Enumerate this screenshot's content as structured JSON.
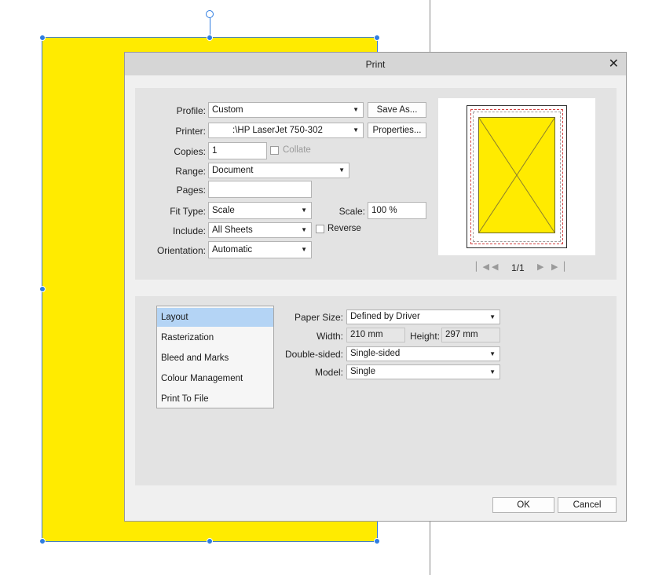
{
  "dialog": {
    "title": "Print",
    "close": "✕"
  },
  "general": {
    "profile": {
      "label": "Profile:",
      "value": "Custom"
    },
    "save_as": "Save As...",
    "printer": {
      "label": "Printer:",
      "value": ":\\HP LaserJet 750-302"
    },
    "properties": "Properties...",
    "copies": {
      "label": "Copies:",
      "value": "1"
    },
    "collate": "Collate",
    "range": {
      "label": "Range:",
      "value": "Document"
    },
    "pages": {
      "label": "Pages:",
      "value": ""
    },
    "fit_type": {
      "label": "Fit Type:",
      "value": "Scale"
    },
    "scale": {
      "label": "Scale:",
      "value": "100 %"
    },
    "include": {
      "label": "Include:",
      "value": "All Sheets"
    },
    "reverse": "Reverse",
    "orientation": {
      "label": "Orientation:",
      "value": "Automatic"
    }
  },
  "preview": {
    "page_counter": "1/1",
    "first_icon": "first-page-icon",
    "prev_icon": "prev-page-icon",
    "next_icon": "next-page-icon",
    "last_icon": "last-page-icon"
  },
  "sections": [
    {
      "label": "Layout",
      "selected": true
    },
    {
      "label": "Rasterization",
      "selected": false
    },
    {
      "label": "Bleed and Marks",
      "selected": false
    },
    {
      "label": "Colour Management",
      "selected": false
    },
    {
      "label": "Print To File",
      "selected": false
    }
  ],
  "layout": {
    "paper_size": {
      "label": "Paper Size:",
      "value": "Defined by Driver"
    },
    "width": {
      "label": "Width:",
      "value": "210 mm"
    },
    "height": {
      "label": "Height:",
      "value": "297 mm"
    },
    "double_sided": {
      "label": "Double-sided:",
      "value": "Single-sided"
    },
    "model": {
      "label": "Model:",
      "value": "Single"
    }
  },
  "footer": {
    "ok": "OK",
    "cancel": "Cancel"
  },
  "colors": {
    "artwork": "#ffeb00",
    "selection": "#2f7de1",
    "list_selected": "#b4d4f5"
  }
}
